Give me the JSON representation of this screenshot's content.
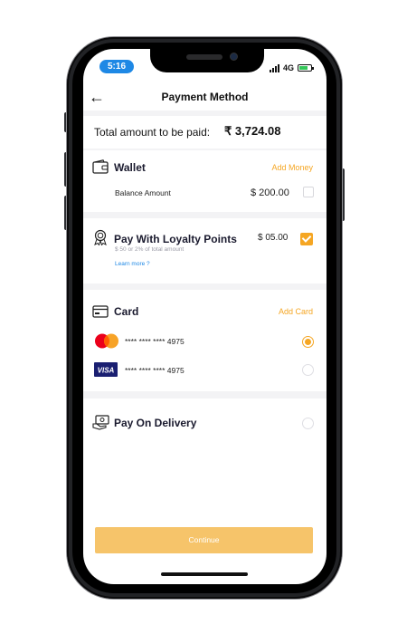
{
  "status": {
    "time": "5:16",
    "network": "4G"
  },
  "header": {
    "title": "Payment Method",
    "back_icon": "←"
  },
  "total": {
    "label": "Total amount to be paid:",
    "amount": "₹ 3,724.08"
  },
  "wallet": {
    "title": "Wallet",
    "link": "Add Money",
    "balance_label": "Balance Amount",
    "balance_value": "$ 200.00",
    "checked": false
  },
  "loyalty": {
    "title": "Pay With Loyalty Points",
    "value": "$ 05.00",
    "note": "$ 50 or 2% of total amount",
    "learn_more": "Learn more ?",
    "checked": true
  },
  "card": {
    "title": "Card",
    "link": "Add Card",
    "cards": [
      {
        "brand": "mastercard",
        "number": "**** **** **** 4975",
        "selected": true
      },
      {
        "brand": "VISA",
        "number": "**** **** **** 4975",
        "selected": false
      }
    ]
  },
  "pod": {
    "title": "Pay On Delivery",
    "selected": false
  },
  "continue_label": "Continue",
  "colors": {
    "accent": "#f5a623",
    "button": "#f6c46a",
    "section_bg": "#f3f3f5"
  }
}
